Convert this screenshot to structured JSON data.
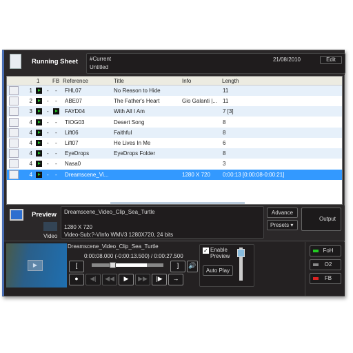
{
  "header": {
    "title": "Running Sheet",
    "playlist": "#Current",
    "name": "Untitled",
    "date": "21/08/2010",
    "edit_label": "Edit"
  },
  "table": {
    "columns": [
      "1",
      "FB",
      "Reference",
      "Title",
      "Info",
      "Length"
    ],
    "rows": [
      {
        "num": "1",
        "c3": "-",
        "fb": "-",
        "ref": "FHL07",
        "title": "No Reason to Hide",
        "info": "",
        "length": "11",
        "icon": "document-icon"
      },
      {
        "num": "2",
        "c3": "-",
        "fb": "-",
        "ref": "ABE07",
        "title": "The Father's Heart",
        "info": "Gio Galanti |...",
        "length": "11",
        "icon": "document-icon"
      },
      {
        "num": "3",
        "c3": "-",
        "fb": "play",
        "ref": "FAYD04",
        "title": "With All I Am",
        "info": "",
        "length": "7 [3]",
        "icon": "document-icon"
      },
      {
        "num": "4",
        "c3": "-",
        "fb": "-",
        "ref": "TIOG03",
        "title": "Desert Song",
        "info": "",
        "length": "8",
        "icon": "document-icon"
      },
      {
        "num": "4",
        "c3": "-",
        "fb": "-",
        "ref": "Lift06",
        "title": "Faithful",
        "info": "",
        "length": "8",
        "icon": "document-icon"
      },
      {
        "num": "4",
        "c3": "-",
        "fb": "-",
        "ref": "Lift07",
        "title": "He Lives In Me",
        "info": "",
        "length": "6",
        "icon": "document-icon"
      },
      {
        "num": "4",
        "c3": "-",
        "fb": "-",
        "ref": "EyeDrops",
        "title": "EyeDrops Folder",
        "info": "",
        "length": "8",
        "icon": "folder-image-icon"
      },
      {
        "num": "4",
        "c3": "-",
        "fb": "-",
        "ref": "Nasa0",
        "title": "",
        "info": "",
        "length": "3",
        "icon": "presentation-icon"
      },
      {
        "num": "4",
        "c3": "-",
        "fb": "-",
        "ref": "Dreamscene_Vi...",
        "title": "",
        "info": "1280 X 720",
        "length": "0:00:13 [0:00:08-0:00:21]",
        "icon": "video-icon",
        "selected": true
      }
    ]
  },
  "preview": {
    "title": "Preview",
    "type_label": "Video",
    "file": "Dreamscene_Video_Clip_Sea_Turtle",
    "resolution": "1280 X 720",
    "details": "Video-Sub:?-VInfo WMV3 1280X720, 24 bits",
    "advance_label": "Advance",
    "presets_label": "Presets",
    "output_label": "Output"
  },
  "player": {
    "file": "Dreamscene_Video_Clip_Sea_Turtle",
    "time": "0:00:08.000 (-0:00:13.500) / 0:00:27.500",
    "progress": 0.29,
    "enable_preview_label": "Enable Preview",
    "enable_preview": true,
    "autoplay_label": "Auto Play",
    "volume": 0.85
  },
  "outputs": [
    {
      "label": "FoH",
      "color": "#22cc22"
    },
    {
      "label": "O2",
      "color": "#888888"
    },
    {
      "label": "FB",
      "color": "#dd2222"
    }
  ]
}
